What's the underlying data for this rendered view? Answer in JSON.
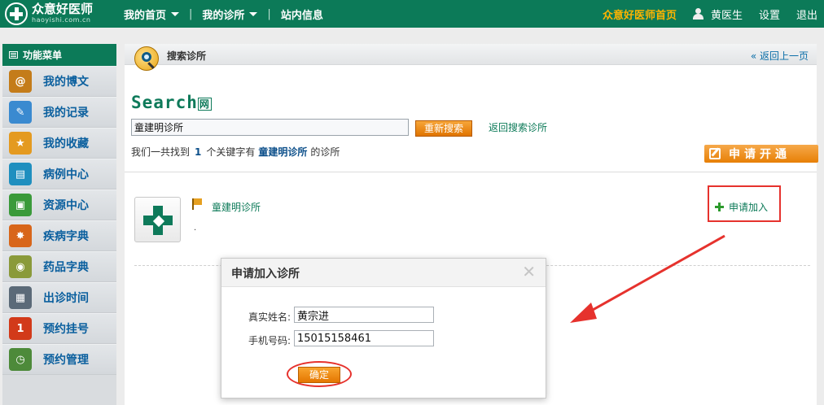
{
  "brand": {
    "name": "众意好医师",
    "domain": "haoyishi.com.cn"
  },
  "nav": {
    "items": [
      "我的首页",
      "我的诊所",
      "站内信息"
    ]
  },
  "topright": {
    "home": "众意好医师首页",
    "user": "黄医生",
    "settings": "设置",
    "logout": "退出"
  },
  "sidebar": {
    "title": "功能菜单",
    "items": [
      {
        "label": "我的博文",
        "icon": "at-icon",
        "color": "#c47c1a",
        "glyph": "@"
      },
      {
        "label": "我的记录",
        "icon": "notepad-icon",
        "color": "#3a8ad0",
        "glyph": "✎"
      },
      {
        "label": "我的收藏",
        "icon": "favorites-icon",
        "color": "#e49a20",
        "glyph": "★"
      },
      {
        "label": "病例中心",
        "icon": "clipboard-icon",
        "color": "#1f8fbf",
        "glyph": "▤"
      },
      {
        "label": "资源中心",
        "icon": "picture-icon",
        "color": "#3a9a3a",
        "glyph": "▣"
      },
      {
        "label": "疾病字典",
        "icon": "virus-icon",
        "color": "#d8661a",
        "glyph": "✸"
      },
      {
        "label": "药品字典",
        "icon": "pills-icon",
        "color": "#8a9a3a",
        "glyph": "◉"
      },
      {
        "label": "出诊时间",
        "icon": "calendar-icon",
        "color": "#5b6a78",
        "glyph": "▦"
      },
      {
        "label": "预约挂号",
        "icon": "number-one-icon",
        "color": "#d23a1a",
        "glyph": "1"
      },
      {
        "label": "预约管理",
        "icon": "clock-icon",
        "color": "#4d8a3a",
        "glyph": "◷"
      }
    ]
  },
  "page": {
    "title": "搜索诊所",
    "back": "« 返回上一页"
  },
  "search": {
    "logo": "Search",
    "logo_suffix": "网",
    "value": "童建明诊所",
    "button": "重新搜索",
    "return_link": "返回搜索诊所",
    "result_prefix": "我们一共找到",
    "result_count": "1",
    "result_mid": "个关键字有",
    "result_keyword": "童建明诊所",
    "result_suffix": "的诊所"
  },
  "apply_open": "申请开通",
  "clinic": {
    "name": "童建明诊所",
    "note": "·",
    "join": "申请加入"
  },
  "modal": {
    "title": "申请加入诊所",
    "name_label": "真实姓名:",
    "name_value": "黄宗进",
    "phone_label": "手机号码:",
    "phone_value": "15015158461",
    "ok": "确定"
  },
  "colors": {
    "brand_green": "#0c7a58",
    "orange": "#e77f06",
    "highlight_red": "#e6322d"
  }
}
